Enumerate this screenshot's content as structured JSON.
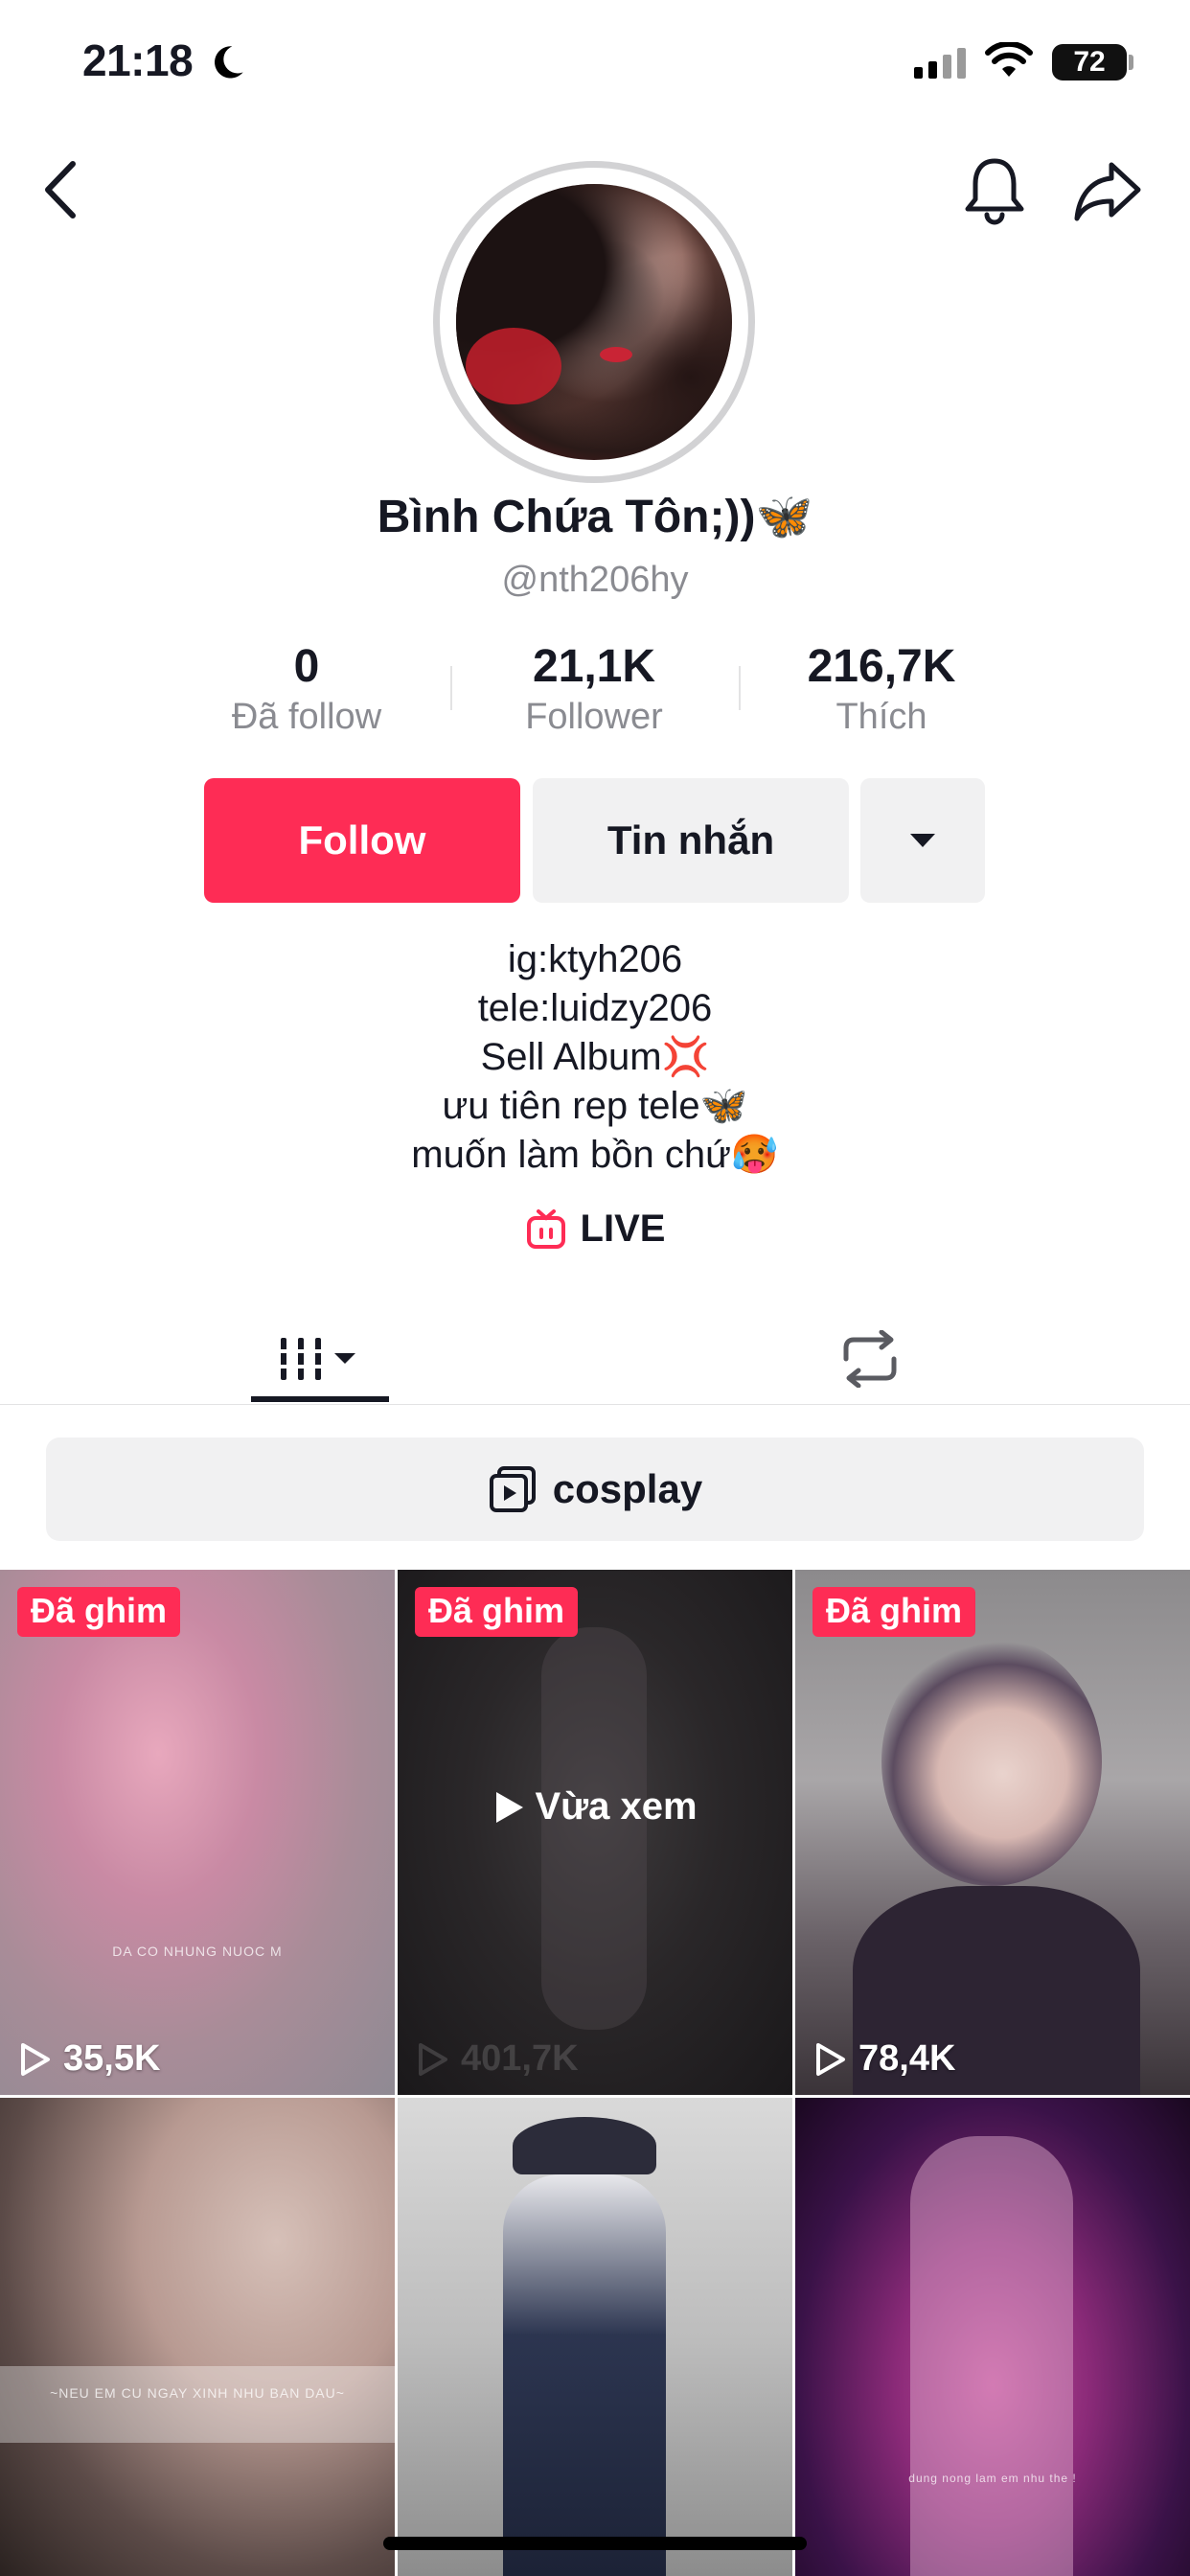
{
  "status_bar": {
    "time": "21:18",
    "battery": "72"
  },
  "profile": {
    "display_name": "Bình Chứa Tôn;))🦋",
    "username": "@nth206hy",
    "stats": [
      {
        "value": "0",
        "label": "Đã follow"
      },
      {
        "value": "21,1K",
        "label": "Follower"
      },
      {
        "value": "216,7K",
        "label": "Thích"
      }
    ]
  },
  "actions": {
    "follow": "Follow",
    "message": "Tin nhắn"
  },
  "bio": {
    "line1": "ig:ktyh206",
    "line2": "tele:luidzy206",
    "line3": "Sell Album💢",
    "line4": "ưu tiên rep tele🦋",
    "line5": "muốn làm bồn chứ🥵"
  },
  "live_label": "LIVE",
  "playlist": {
    "label": "cosplay"
  },
  "videos": [
    {
      "pinned": "Đã ghim",
      "views": "35,5K",
      "caption": "DA CO NHUNG NUOC M"
    },
    {
      "pinned": "Đã ghim",
      "views": "401,7K",
      "watched": "Vừa xem"
    },
    {
      "pinned": "Đã ghim",
      "views": "78,4K"
    },
    {
      "caption": "~NEU EM CU NGAY XINH NHU BAN DAU~"
    },
    {},
    {
      "caption": "dung nong lam em nhu the !"
    }
  ],
  "colors": {
    "accent": "#fe2c55",
    "text": "#161823",
    "muted": "#8a8b91",
    "button_gray": "#f1f1f2"
  }
}
